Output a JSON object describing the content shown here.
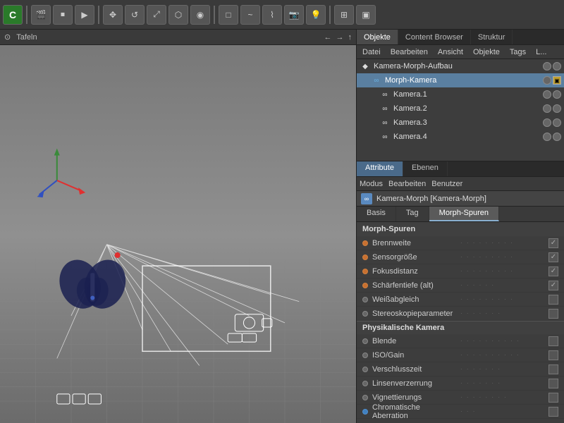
{
  "toolbar": {
    "logo": "C",
    "icons": [
      "film",
      "film2",
      "film3",
      "cube",
      "sphere",
      "twist",
      "gear",
      "light",
      "camera",
      "dots",
      "bulb"
    ]
  },
  "viewport": {
    "header_left": "⊙",
    "header_label": "Tafeln",
    "nav_arrows": "← → ↑"
  },
  "right_panel": {
    "top_tabs": [
      "Objekte",
      "Content Browser",
      "Struktur"
    ],
    "active_top_tab": "Objekte",
    "menu_items": [
      "Datei",
      "Bearbeiten",
      "Ansicht",
      "Objekte",
      "Tags",
      "L..."
    ]
  },
  "object_tree": {
    "items": [
      {
        "name": "Kamera-Morph-Aufbau",
        "indent": 0,
        "icon": "◆",
        "has_vis": true,
        "selected": false
      },
      {
        "name": "Morph-Kamera",
        "indent": 1,
        "icon": "∞",
        "has_vis": true,
        "selected": true
      },
      {
        "name": "Kamera.1",
        "indent": 2,
        "icon": "∞",
        "has_vis": true,
        "selected": false
      },
      {
        "name": "Kamera.2",
        "indent": 2,
        "icon": "∞",
        "has_vis": true,
        "selected": false
      },
      {
        "name": "Kamera.3",
        "indent": 2,
        "icon": "∞",
        "has_vis": true,
        "selected": false
      },
      {
        "name": "Kamera.4",
        "indent": 2,
        "icon": "∞",
        "has_vis": true,
        "selected": false
      }
    ]
  },
  "attr_panel": {
    "tabs": [
      "Attribute",
      "Ebenen"
    ],
    "active_tab": "Attribute",
    "menu_items": [
      "Modus",
      "Bearbeiten",
      "Benutzer"
    ],
    "object_name": "Kamera-Morph [Kamera-Morph]",
    "sub_tabs": [
      "Basis",
      "Tag",
      "Morph-Spuren"
    ],
    "active_sub_tab": "Morph-Spuren",
    "section1_title": "Morph-Spuren",
    "morph_rows": [
      {
        "name": "Brennweite",
        "checked": true
      },
      {
        "name": "Sensorgröße",
        "checked": true
      },
      {
        "name": "Fokusdistanz",
        "checked": true
      },
      {
        "name": "Schärfentiefe (alt)",
        "checked": true
      },
      {
        "name": "Weißabgleich",
        "checked": false
      },
      {
        "name": "Stereoskopieparameter",
        "checked": false
      }
    ],
    "section2_title": "Physikalische Kamera",
    "physical_rows": [
      {
        "name": "Blende",
        "checked": false
      },
      {
        "name": "ISO/Gain",
        "checked": false
      },
      {
        "name": "Verschlusszeit",
        "checked": false
      },
      {
        "name": "Linsenverzerrung",
        "checked": false
      },
      {
        "name": "Vignettierungs",
        "checked": false
      },
      {
        "name": "Chromatische Aberration",
        "checked": false
      }
    ]
  }
}
